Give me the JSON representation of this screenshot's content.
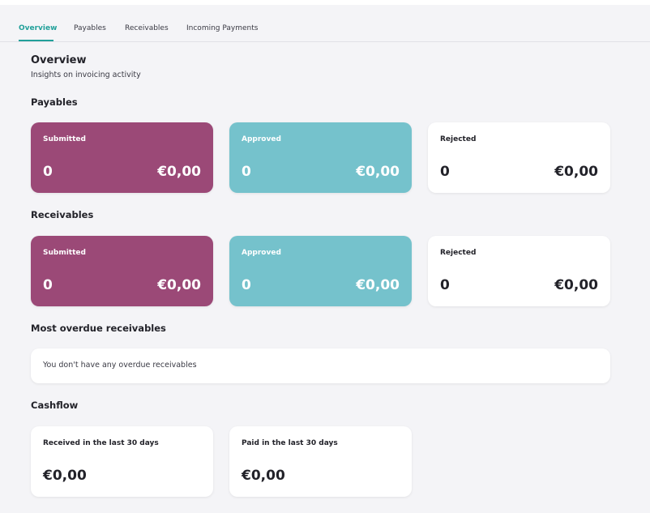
{
  "tabs": [
    {
      "label": "Overview",
      "active": true
    },
    {
      "label": "Payables",
      "active": false
    },
    {
      "label": "Receivables",
      "active": false
    },
    {
      "label": "Incoming Payments",
      "active": false
    }
  ],
  "header": {
    "title": "Overview",
    "subtitle": "Insights on invoicing activity"
  },
  "payables": {
    "heading": "Payables",
    "submitted": {
      "label": "Submitted",
      "count": "0",
      "amount": "€0,00"
    },
    "approved": {
      "label": "Approved",
      "count": "0",
      "amount": "€0,00"
    },
    "rejected": {
      "label": "Rejected",
      "count": "0",
      "amount": "€0,00"
    }
  },
  "receivables": {
    "heading": "Receivables",
    "submitted": {
      "label": "Submitted",
      "count": "0",
      "amount": "€0,00"
    },
    "approved": {
      "label": "Approved",
      "count": "0",
      "amount": "€0,00"
    },
    "rejected": {
      "label": "Rejected",
      "count": "0",
      "amount": "€0,00"
    }
  },
  "overdue": {
    "heading": "Most overdue receivables",
    "empty_message": "You don't have any overdue receivables"
  },
  "cashflow": {
    "heading": "Cashflow",
    "received": {
      "label": "Received in the last 30 days",
      "amount": "€0,00"
    },
    "paid": {
      "label": "Paid in the last 30 days",
      "amount": "€0,00"
    }
  },
  "colors": {
    "accent": "#22a09a",
    "submitted": "#9b4977",
    "approved": "#75c2cc",
    "background": "#f4f4f7"
  }
}
